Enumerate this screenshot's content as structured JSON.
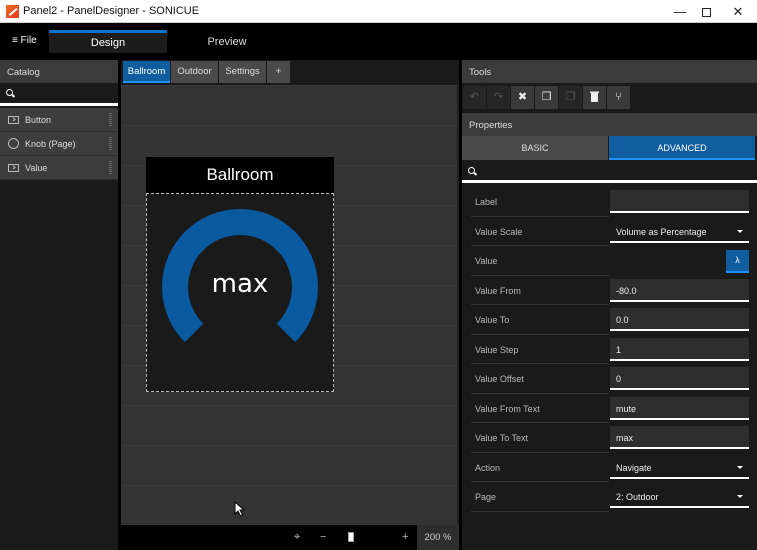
{
  "window": {
    "title": "Panel2 - PanelDesigner - SONICUE",
    "minimize": "—",
    "close": "✕"
  },
  "nav": {
    "file_label": "≡ File",
    "tabs": [
      {
        "label": "Design",
        "active": true
      },
      {
        "label": "Preview",
        "active": false
      }
    ]
  },
  "catalog": {
    "title": "Catalog",
    "search_value": "",
    "items": [
      {
        "label": "Button",
        "icon": "button-icon"
      },
      {
        "label": "Knob (Page)",
        "icon": "knob-icon"
      },
      {
        "label": "Value",
        "icon": "value-icon"
      }
    ]
  },
  "pages": {
    "tabs": [
      {
        "label": "Ballroom",
        "active": true
      },
      {
        "label": "Outdoor",
        "active": false
      },
      {
        "label": "Settings",
        "active": false
      },
      {
        "label": "+",
        "active": false
      }
    ]
  },
  "canvas": {
    "page_title": "Ballroom",
    "knob": {
      "display_text": "max",
      "color": "#0a5aa0",
      "fill_fraction": 1.0
    },
    "zoom": {
      "center_icon": "⌖",
      "minus": "−",
      "plus": "+",
      "level": "200 %"
    }
  },
  "tools": {
    "title": "Tools",
    "buttons": [
      {
        "name": "undo",
        "glyph": "↶",
        "enabled": false
      },
      {
        "name": "redo",
        "glyph": "↷",
        "enabled": false
      },
      {
        "name": "cut",
        "glyph": "✖",
        "enabled": true
      },
      {
        "name": "copy",
        "glyph": "❐",
        "enabled": true
      },
      {
        "name": "paste",
        "glyph": "❐",
        "enabled": false
      },
      {
        "name": "delete",
        "glyph": "🗑",
        "enabled": true
      },
      {
        "name": "branch",
        "glyph": "⑂",
        "enabled": true
      }
    ]
  },
  "properties": {
    "title": "Properties",
    "tabs": [
      {
        "label": "BASIC",
        "active": false
      },
      {
        "label": "ADVANCED",
        "active": true
      }
    ],
    "search_value": "",
    "rows": [
      {
        "label": "Label",
        "type": "input",
        "value": ""
      },
      {
        "label": "Value Scale",
        "type": "select",
        "value": "Volume as Percentage"
      },
      {
        "label": "Value",
        "type": "lambda",
        "value": "λ"
      },
      {
        "label": "Value From",
        "type": "input",
        "value": "-80.0"
      },
      {
        "label": "Value To",
        "type": "input",
        "value": "0.0"
      },
      {
        "label": "Value Step",
        "type": "input",
        "value": "1"
      },
      {
        "label": "Value Offset",
        "type": "input",
        "value": "0"
      },
      {
        "label": "Value From Text",
        "type": "input",
        "value": "mute"
      },
      {
        "label": "Value To Text",
        "type": "input",
        "value": "max"
      },
      {
        "label": "Action",
        "type": "select",
        "value": "Navigate"
      },
      {
        "label": "Page",
        "type": "select",
        "value": "2: Outdoor"
      }
    ]
  },
  "colors": {
    "accent": "#0f5c9e",
    "accent_highlight": "#1e90ff",
    "panel_bg": "#1a1a1a"
  }
}
